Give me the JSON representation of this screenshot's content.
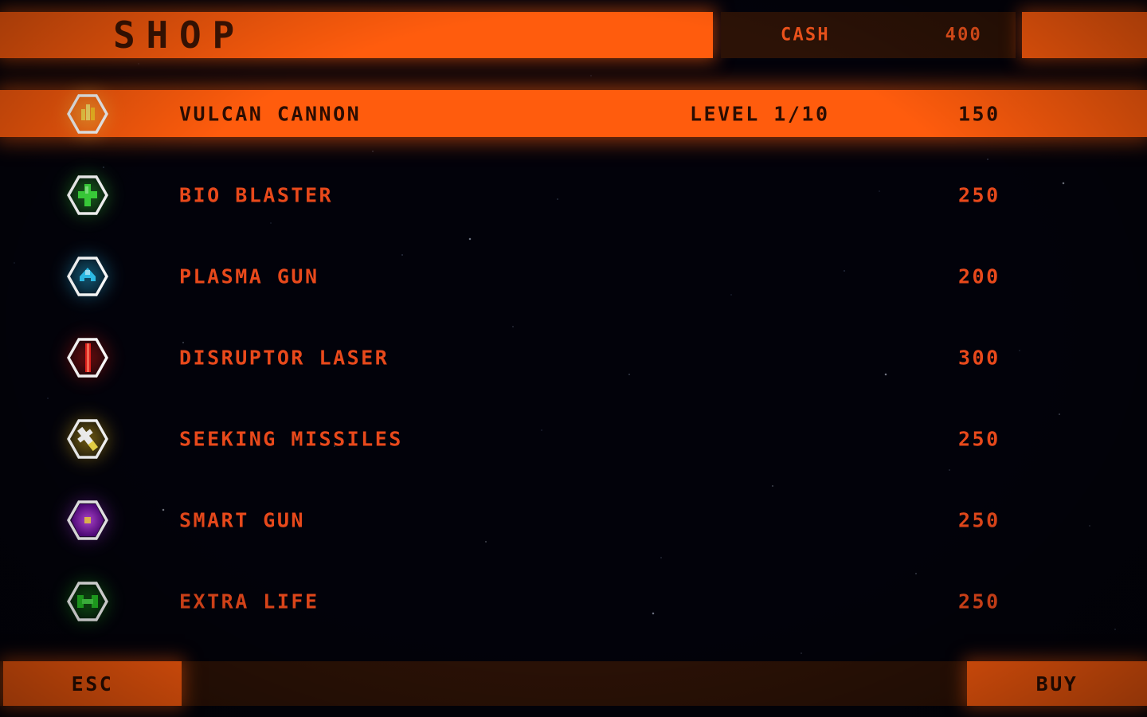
{
  "header": {
    "title": "SHOP",
    "cash_label": "CASH",
    "cash_value": "400"
  },
  "items": [
    {
      "name": "VULCAN CANNON",
      "price": "150",
      "level": "LEVEL 1/10",
      "selected": true,
      "icon": "vulcan-cannon-icon",
      "color": "#ffc324"
    },
    {
      "name": "BIO BLASTER",
      "price": "250",
      "level": "",
      "selected": false,
      "icon": "bio-blaster-icon",
      "color": "#3ddb3d"
    },
    {
      "name": "PLASMA GUN",
      "price": "200",
      "level": "",
      "selected": false,
      "icon": "plasma-gun-icon",
      "color": "#2fc3ef"
    },
    {
      "name": "DISRUPTOR LASER",
      "price": "300",
      "level": "",
      "selected": false,
      "icon": "disruptor-laser-icon",
      "color": "#e8201c"
    },
    {
      "name": "SEEKING MISSILES",
      "price": "250",
      "level": "",
      "selected": false,
      "icon": "seeking-missiles-icon",
      "color": "#f7e04a"
    },
    {
      "name": "SMART GUN",
      "price": "250",
      "level": "",
      "selected": false,
      "icon": "smart-gun-icon",
      "color": "#9b21d6"
    },
    {
      "name": "EXTRA LIFE",
      "price": "250",
      "level": "",
      "selected": false,
      "icon": "extra-life-icon",
      "color": "#25c225"
    }
  ],
  "footer": {
    "esc_label": "ESC",
    "buy_label": "BUY"
  },
  "theme": {
    "accent_orange": "#ff5c0d",
    "text_orange": "#e8491b",
    "dark_panel": "#2c1206",
    "dark_text": "#2b0d02",
    "background": "#02020a"
  }
}
